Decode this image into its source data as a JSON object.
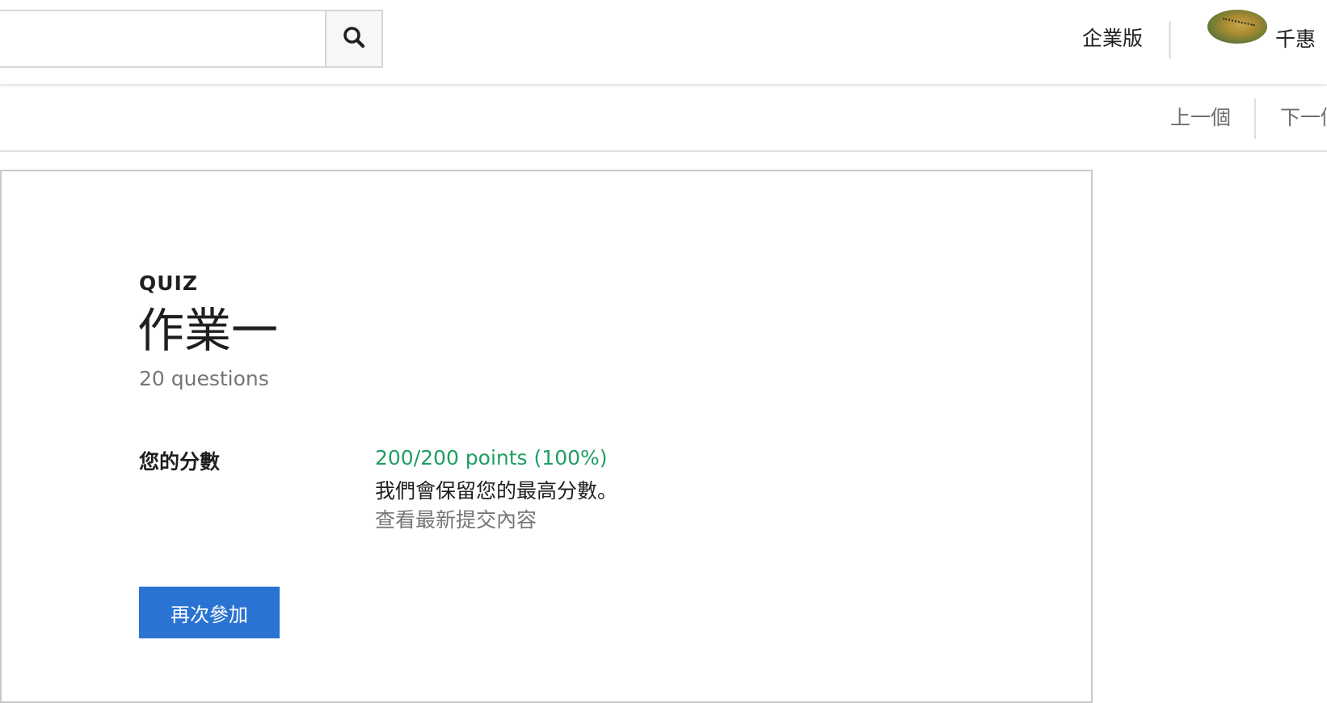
{
  "header": {
    "search": {
      "value": "",
      "placeholder": ""
    },
    "search_icon": "search-icon",
    "enterprise_label": "企業版",
    "user": {
      "name": "千惠",
      "avatar": "avatar"
    }
  },
  "subnav": {
    "prev_label": "上一個",
    "next_label": "下一個"
  },
  "quiz": {
    "type_label": "QUIZ",
    "title": "作業一",
    "question_count": "20 questions",
    "score_label": "您的分數",
    "score_value": "200/200 points (100%)",
    "score_note": "我們會保留您的最高分數。",
    "latest_submission_link": "查看最新提交內容",
    "retake_button": "再次參加"
  },
  "colors": {
    "accent": "#2a73d3",
    "score_green": "#1f9e63",
    "muted_text": "#757575"
  }
}
